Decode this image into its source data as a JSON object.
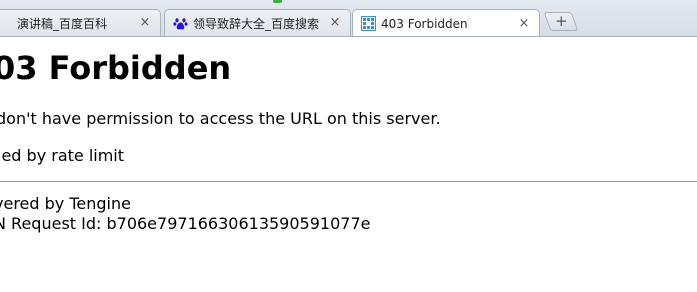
{
  "browser": {
    "tabs": [
      {
        "title": "演讲稿_百度百科",
        "icon": "baike-icon",
        "close_label": "×",
        "active": false
      },
      {
        "title": "领导致辞大全_百度搜索",
        "icon": "baidu-paw-icon",
        "close_label": "×",
        "active": false
      },
      {
        "title": "403 Forbidden",
        "icon": "page-grid-icon",
        "close_label": "×",
        "active": true
      }
    ],
    "new_tab_label": "+"
  },
  "page": {
    "heading": "03 Forbidden",
    "message": " don't have permission to access the URL on this server.",
    "reason": "ied by rate limit",
    "powered_by": "vered by Tengine",
    "request_id": "N Request Id: b706e7971663061359059107​7e"
  },
  "colors": {
    "tab_strip": "#d6dde7",
    "tab_border": "#a9b3c0",
    "baidu_blue": "#2319dc",
    "accent_green": "#3cb043",
    "rule": "#9a9a9a"
  }
}
